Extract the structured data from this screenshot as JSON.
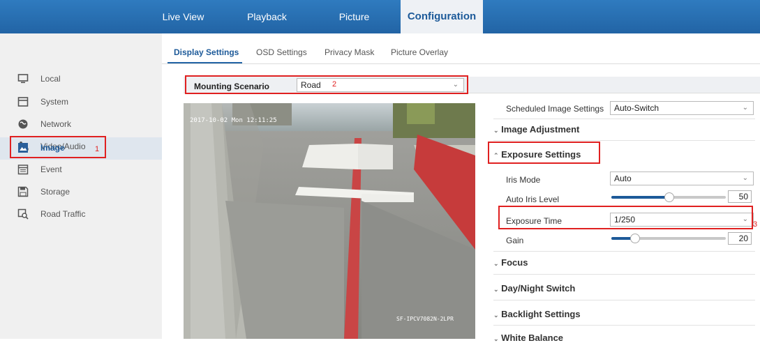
{
  "nav": {
    "tabs": [
      "Live View",
      "Playback",
      "Picture",
      "Configuration"
    ],
    "active": "Configuration"
  },
  "sidebar": {
    "items": [
      {
        "label": "Local",
        "icon": "monitor-icon"
      },
      {
        "label": "System",
        "icon": "system-icon"
      },
      {
        "label": "Network",
        "icon": "globe-icon"
      },
      {
        "label": "Video/Audio",
        "icon": "microphone-icon"
      },
      {
        "label": "Image",
        "icon": "image-icon"
      },
      {
        "label": "Event",
        "icon": "calendar-icon"
      },
      {
        "label": "Storage",
        "icon": "floppy-disk-icon"
      },
      {
        "label": "Road Traffic",
        "icon": "road-traffic-icon"
      }
    ],
    "active": "Image"
  },
  "subtabs": [
    "Display Settings",
    "OSD Settings",
    "Privacy Mask",
    "Picture Overlay"
  ],
  "mounting": {
    "label": "Mounting Scenario",
    "value": "Road"
  },
  "annotations": {
    "one": "1",
    "two": "2",
    "three": "3"
  },
  "camera": {
    "osd_time": "2017-10-02 Mon 12:11:25",
    "osd_name": "SF-IPCV7082N-2LPR"
  },
  "settings": {
    "scheduled": {
      "label": "Scheduled Image Settings",
      "value": "Auto-Switch"
    },
    "image_adjustment": "Image Adjustment",
    "exposure_settings": "Exposure Settings",
    "iris_mode": {
      "label": "Iris Mode",
      "value": "Auto"
    },
    "auto_iris_level": {
      "label": "Auto Iris Level",
      "value": "50"
    },
    "exposure_time": {
      "label": "Exposure Time",
      "value": "1/250"
    },
    "gain": {
      "label": "Gain",
      "value": "20"
    },
    "focus": "Focus",
    "day_night": "Day/Night Switch",
    "backlight": "Backlight Settings",
    "white_balance": "White Balance"
  },
  "colors": {
    "nav_blue": "#2468a8",
    "highlight_red": "#e02020",
    "accent": "#1d5a99"
  }
}
